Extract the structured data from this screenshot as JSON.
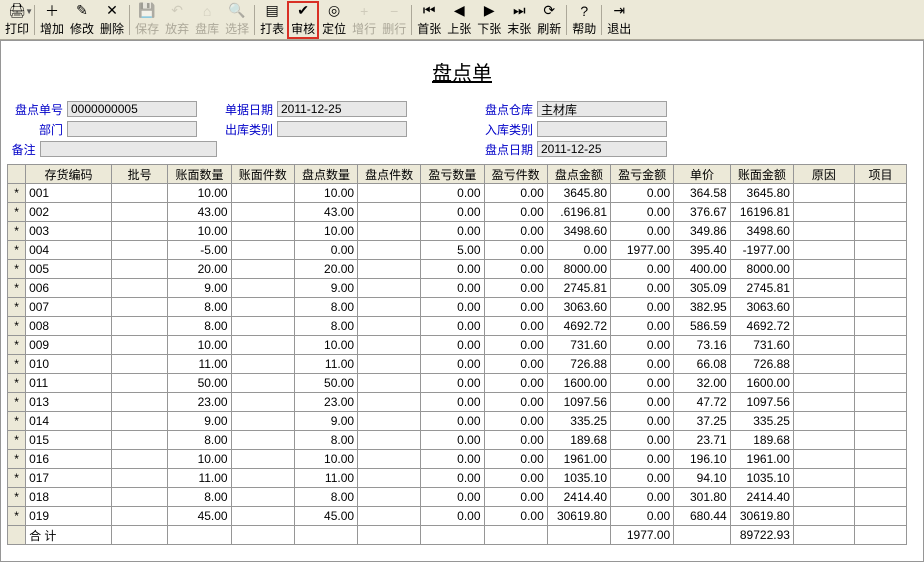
{
  "toolbar": [
    {
      "name": "print",
      "label": "打印",
      "icon": "🖨",
      "drop": true
    },
    {
      "name": "add",
      "label": "增加",
      "icon": "＋"
    },
    {
      "name": "edit",
      "label": "修改",
      "icon": "✎"
    },
    {
      "name": "delete",
      "label": "删除",
      "icon": "✕"
    },
    {
      "name": "save",
      "label": "保存",
      "icon": "💾",
      "disabled": true
    },
    {
      "name": "discard",
      "label": "放弃",
      "icon": "↶",
      "disabled": true
    },
    {
      "name": "warehouse",
      "label": "盘库",
      "icon": "⌂",
      "disabled": true
    },
    {
      "name": "select",
      "label": "选择",
      "icon": "🔍",
      "disabled": true
    },
    {
      "name": "report",
      "label": "打表",
      "icon": "▤"
    },
    {
      "name": "audit",
      "label": "审核",
      "icon": "✔",
      "highlight": true
    },
    {
      "name": "locate",
      "label": "定位",
      "icon": "◎"
    },
    {
      "name": "addrow",
      "label": "增行",
      "icon": "+",
      "disabled": true
    },
    {
      "name": "delrow",
      "label": "删行",
      "icon": "−",
      "disabled": true
    },
    {
      "name": "first",
      "label": "首张",
      "icon": "⏮"
    },
    {
      "name": "prev",
      "label": "上张",
      "icon": "◀"
    },
    {
      "name": "next",
      "label": "下张",
      "icon": "▶"
    },
    {
      "name": "last",
      "label": "末张",
      "icon": "⏭"
    },
    {
      "name": "refresh",
      "label": "刷新",
      "icon": "⟳"
    },
    {
      "name": "help",
      "label": "帮助",
      "icon": "?"
    },
    {
      "name": "exit",
      "label": "退出",
      "icon": "⇥"
    }
  ],
  "title": "盘点单",
  "header": {
    "l1": {
      "label": "盘点单号",
      "value": "0000000005"
    },
    "l2": {
      "label": "部门",
      "value": ""
    },
    "l3": {
      "label": "备注",
      "value": ""
    },
    "m1": {
      "label": "单据日期",
      "value": "2011-12-25"
    },
    "m2": {
      "label": "出库类别",
      "value": ""
    },
    "r1": {
      "label": "盘点仓库",
      "value": "主材库"
    },
    "r2": {
      "label": "入库类别",
      "value": ""
    },
    "r3": {
      "label": "盘点日期",
      "value": "2011-12-25"
    }
  },
  "columns": [
    "存货编码",
    "批号",
    "账面数量",
    "账面件数",
    "盘点数量",
    "盘点件数",
    "盈亏数量",
    "盈亏件数",
    "盘点金额",
    "盈亏金额",
    "单价",
    "账面金额",
    "原因",
    "项目"
  ],
  "rows": [
    {
      "code": "001",
      "book_qty": "10.00",
      "count_qty": "10.00",
      "pl_qty": "0.00",
      "pl_pcs": "0.00",
      "count_amt": "3645.80",
      "pl_amt": "0.00",
      "price": "364.58",
      "book_amt": "3645.80"
    },
    {
      "code": "002",
      "book_qty": "43.00",
      "count_qty": "43.00",
      "pl_qty": "0.00",
      "pl_pcs": "0.00",
      "count_amt": ".6196.81",
      "pl_amt": "0.00",
      "price": "376.67",
      "book_amt": "16196.81"
    },
    {
      "code": "003",
      "book_qty": "10.00",
      "count_qty": "10.00",
      "pl_qty": "0.00",
      "pl_pcs": "0.00",
      "count_amt": "3498.60",
      "pl_amt": "0.00",
      "price": "349.86",
      "book_amt": "3498.60"
    },
    {
      "code": "004",
      "book_qty": "-5.00",
      "count_qty": "0.00",
      "pl_qty": "5.00",
      "pl_pcs": "0.00",
      "count_amt": "0.00",
      "pl_amt": "1977.00",
      "price": "395.40",
      "book_amt": "-1977.00"
    },
    {
      "code": "005",
      "book_qty": "20.00",
      "count_qty": "20.00",
      "pl_qty": "0.00",
      "pl_pcs": "0.00",
      "count_amt": "8000.00",
      "pl_amt": "0.00",
      "price": "400.00",
      "book_amt": "8000.00"
    },
    {
      "code": "006",
      "book_qty": "9.00",
      "count_qty": "9.00",
      "pl_qty": "0.00",
      "pl_pcs": "0.00",
      "count_amt": "2745.81",
      "pl_amt": "0.00",
      "price": "305.09",
      "book_amt": "2745.81"
    },
    {
      "code": "007",
      "book_qty": "8.00",
      "count_qty": "8.00",
      "pl_qty": "0.00",
      "pl_pcs": "0.00",
      "count_amt": "3063.60",
      "pl_amt": "0.00",
      "price": "382.95",
      "book_amt": "3063.60"
    },
    {
      "code": "008",
      "book_qty": "8.00",
      "count_qty": "8.00",
      "pl_qty": "0.00",
      "pl_pcs": "0.00",
      "count_amt": "4692.72",
      "pl_amt": "0.00",
      "price": "586.59",
      "book_amt": "4692.72"
    },
    {
      "code": "009",
      "book_qty": "10.00",
      "count_qty": "10.00",
      "pl_qty": "0.00",
      "pl_pcs": "0.00",
      "count_amt": "731.60",
      "pl_amt": "0.00",
      "price": "73.16",
      "book_amt": "731.60"
    },
    {
      "code": "010",
      "book_qty": "11.00",
      "count_qty": "11.00",
      "pl_qty": "0.00",
      "pl_pcs": "0.00",
      "count_amt": "726.88",
      "pl_amt": "0.00",
      "price": "66.08",
      "book_amt": "726.88"
    },
    {
      "code": "011",
      "book_qty": "50.00",
      "count_qty": "50.00",
      "pl_qty": "0.00",
      "pl_pcs": "0.00",
      "count_amt": "1600.00",
      "pl_amt": "0.00",
      "price": "32.00",
      "book_amt": "1600.00"
    },
    {
      "code": "013",
      "book_qty": "23.00",
      "count_qty": "23.00",
      "pl_qty": "0.00",
      "pl_pcs": "0.00",
      "count_amt": "1097.56",
      "pl_amt": "0.00",
      "price": "47.72",
      "book_amt": "1097.56"
    },
    {
      "code": "014",
      "book_qty": "9.00",
      "count_qty": "9.00",
      "pl_qty": "0.00",
      "pl_pcs": "0.00",
      "count_amt": "335.25",
      "pl_amt": "0.00",
      "price": "37.25",
      "book_amt": "335.25"
    },
    {
      "code": "015",
      "book_qty": "8.00",
      "count_qty": "8.00",
      "pl_qty": "0.00",
      "pl_pcs": "0.00",
      "count_amt": "189.68",
      "pl_amt": "0.00",
      "price": "23.71",
      "book_amt": "189.68"
    },
    {
      "code": "016",
      "book_qty": "10.00",
      "count_qty": "10.00",
      "pl_qty": "0.00",
      "pl_pcs": "0.00",
      "count_amt": "1961.00",
      "pl_amt": "0.00",
      "price": "196.10",
      "book_amt": "1961.00"
    },
    {
      "code": "017",
      "book_qty": "11.00",
      "count_qty": "11.00",
      "pl_qty": "0.00",
      "pl_pcs": "0.00",
      "count_amt": "1035.10",
      "pl_amt": "0.00",
      "price": "94.10",
      "book_amt": "1035.10"
    },
    {
      "code": "018",
      "book_qty": "8.00",
      "count_qty": "8.00",
      "pl_qty": "0.00",
      "pl_pcs": "0.00",
      "count_amt": "2414.40",
      "pl_amt": "0.00",
      "price": "301.80",
      "book_amt": "2414.40"
    },
    {
      "code": "019",
      "book_qty": "45.00",
      "count_qty": "45.00",
      "pl_qty": "0.00",
      "pl_pcs": "0.00",
      "count_amt": "30619.80",
      "pl_amt": "0.00",
      "price": "680.44",
      "book_amt": "30619.80"
    }
  ],
  "totals": {
    "label": "合  计",
    "pl_amt": "1977.00",
    "book_amt": "89722.93"
  }
}
